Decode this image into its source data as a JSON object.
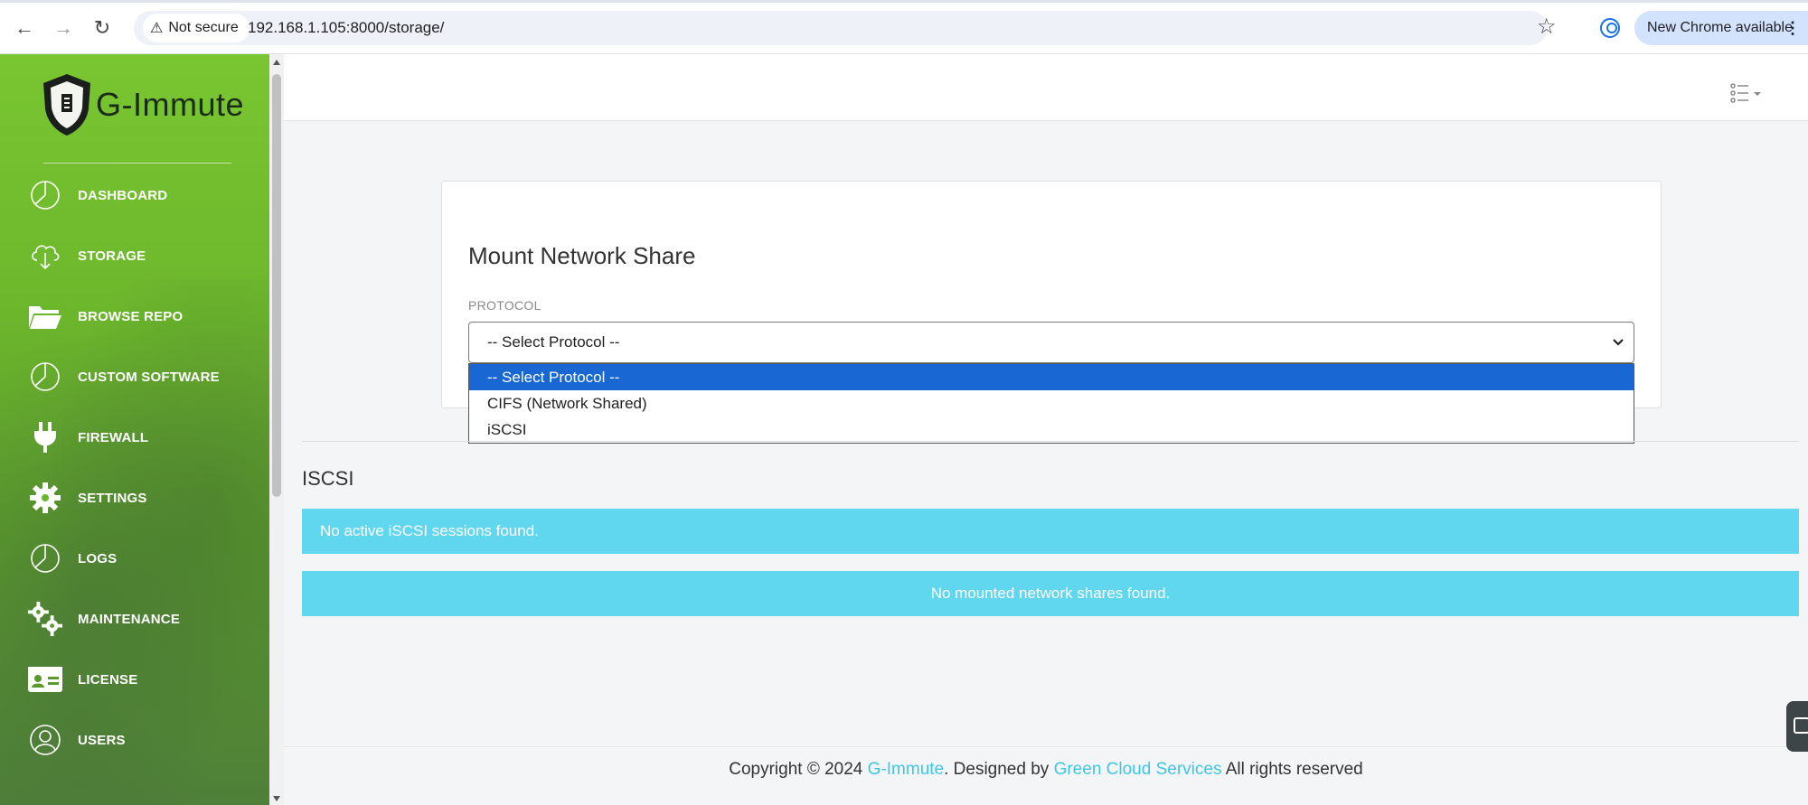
{
  "browser": {
    "security_label": "Not secure",
    "url": "192.168.1.105:8000/storage/",
    "update_label": "New Chrome available"
  },
  "brand": {
    "name": "G-Immute"
  },
  "sidebar": {
    "items": [
      {
        "label": "DASHBOARD",
        "icon": "pie-chart-icon"
      },
      {
        "label": "STORAGE",
        "icon": "cloud-download-icon"
      },
      {
        "label": "BROWSE REPO",
        "icon": "folder-open-icon"
      },
      {
        "label": "CUSTOM SOFTWARE",
        "icon": "pie-chart-icon"
      },
      {
        "label": "FIREWALL",
        "icon": "plug-icon"
      },
      {
        "label": "SETTINGS",
        "icon": "gear-icon"
      },
      {
        "label": "LOGS",
        "icon": "pie-chart-icon"
      },
      {
        "label": "MAINTENANCE",
        "icon": "gears-icon"
      },
      {
        "label": "LICENSE",
        "icon": "id-card-icon"
      },
      {
        "label": "USERS",
        "icon": "user-circle-icon"
      }
    ]
  },
  "mount_card": {
    "title": "Mount Network Share",
    "protocol_label": "PROTOCOL",
    "selected": "-- Select Protocol --",
    "options": [
      "-- Select Protocol --",
      "CIFS (Network Shared)",
      "iSCSI"
    ]
  },
  "iscsi": {
    "title": "ISCSI",
    "no_sessions": "No active iSCSI sessions found."
  },
  "shares": {
    "no_shares": "No mounted network shares found."
  },
  "footer": {
    "prefix": "Copyright © 2024",
    "brand_link": "G-Immute",
    "designed_by": ". Designed by",
    "company_link": "Green Cloud Services",
    "suffix": "All rights reserved"
  },
  "colors": {
    "sidebar_green": "#79c631",
    "alert_cyan": "#61d6ef",
    "link_cyan": "#3ec6e6",
    "select_highlight": "#1967d2"
  }
}
